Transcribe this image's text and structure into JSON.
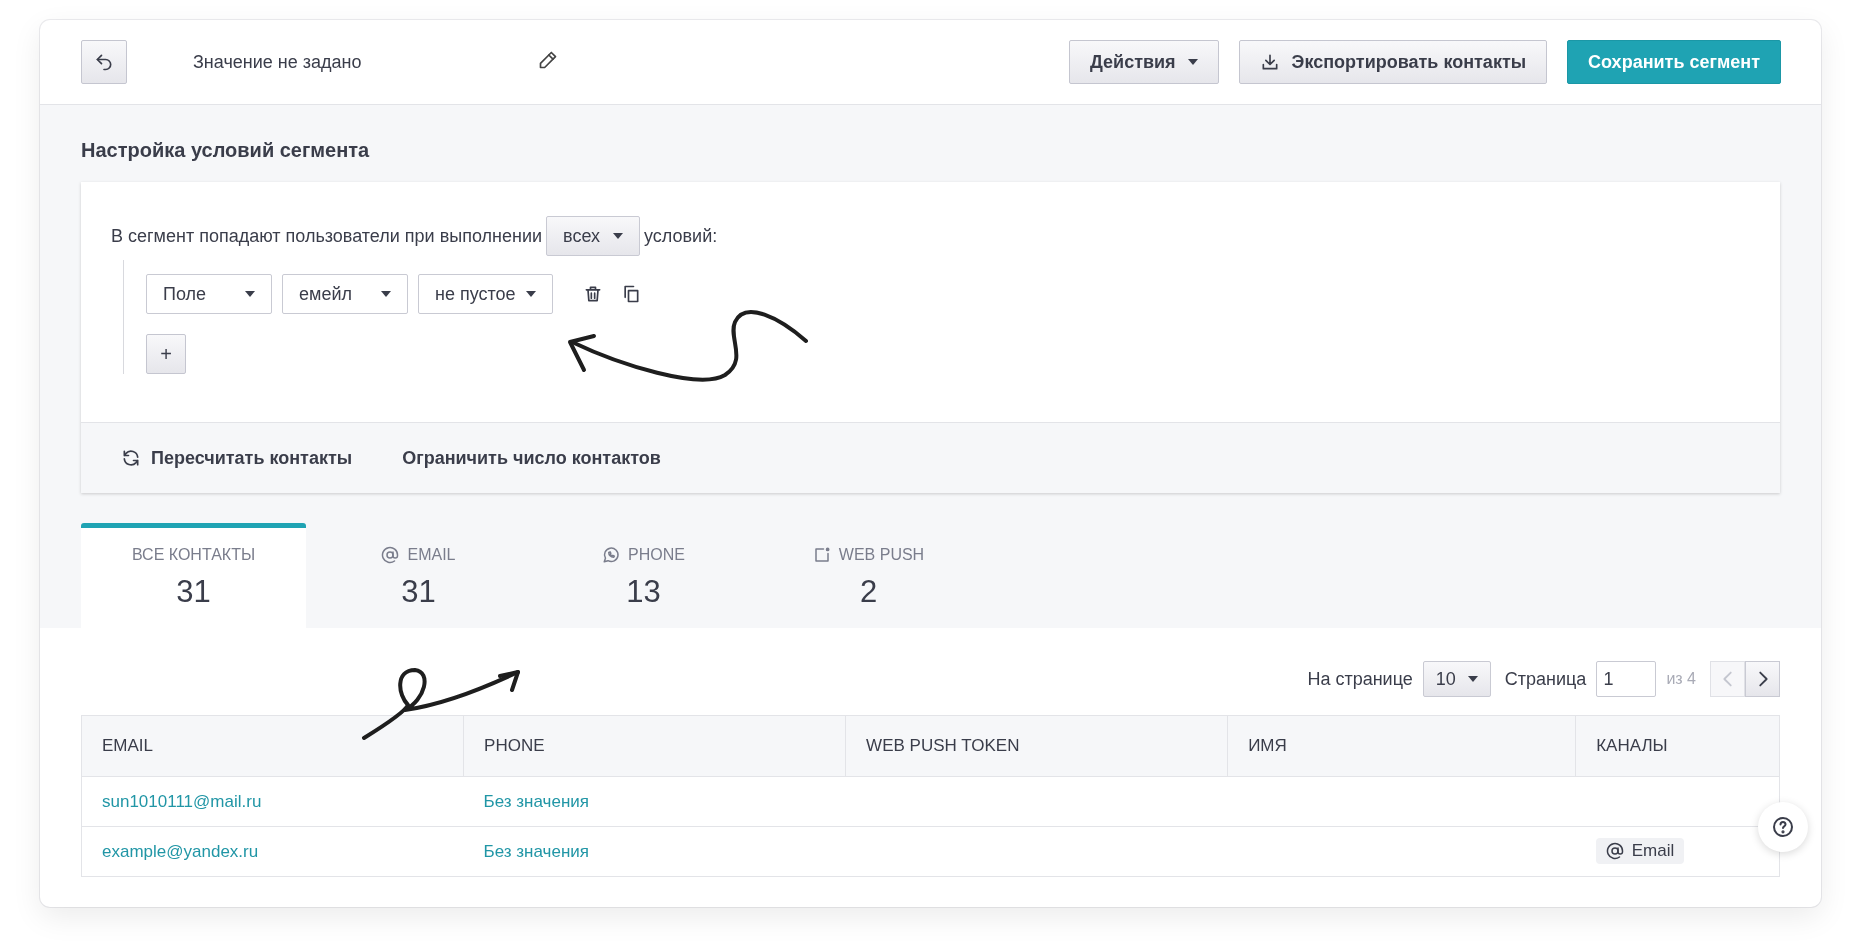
{
  "header": {
    "title": "Значение не задано",
    "actions": [
      {
        "kind": "dropdown",
        "label": "Действия"
      },
      {
        "kind": "export",
        "label": "Экспортировать контакты"
      },
      {
        "kind": "primary",
        "label": "Сохранить сегмент"
      }
    ]
  },
  "conditions": {
    "heading": "Настройка условий сегмента",
    "intro_before": "В сегмент попадают пользователи при выполнении",
    "match_select": "всех",
    "intro_after": "условий:",
    "rule_selects": [
      "Поле",
      "емейл",
      "не пустое"
    ],
    "add_button": "+",
    "footer_actions": [
      {
        "kind": "recalc",
        "label": "Пересчитать контакты"
      },
      {
        "kind": "plain",
        "label": "Ограничить число контактов"
      }
    ]
  },
  "tabs": [
    {
      "kind": "all",
      "label": "ВСЕ КОНТАКТЫ",
      "count": "31",
      "selected": true
    },
    {
      "kind": "email",
      "label": "EMAIL",
      "count": "31",
      "selected": false
    },
    {
      "kind": "phone",
      "label": "PHONE",
      "count": "13",
      "selected": false
    },
    {
      "kind": "webpush",
      "label": "WEB PUSH",
      "count": "2",
      "selected": false
    }
  ],
  "pagination": {
    "per_page_label": "На странице",
    "per_page": "10",
    "page_label": "Страница",
    "page": "1",
    "total": "из 4",
    "prev": {
      "disabled": true
    },
    "next": {
      "disabled": false
    }
  },
  "table": {
    "columns": [
      "EMAIL",
      "PHONE",
      "WEB PUSH TOKEN",
      "ИМЯ",
      "КАНАЛЫ"
    ],
    "rows": [
      {
        "email": "sun1010111@mail.ru",
        "phone": "Без значения",
        "channels": []
      },
      {
        "email": "example@yandex.ru",
        "phone": "Без значения",
        "channels": [
          {
            "kind": "email",
            "label": "Email"
          }
        ]
      }
    ]
  }
}
